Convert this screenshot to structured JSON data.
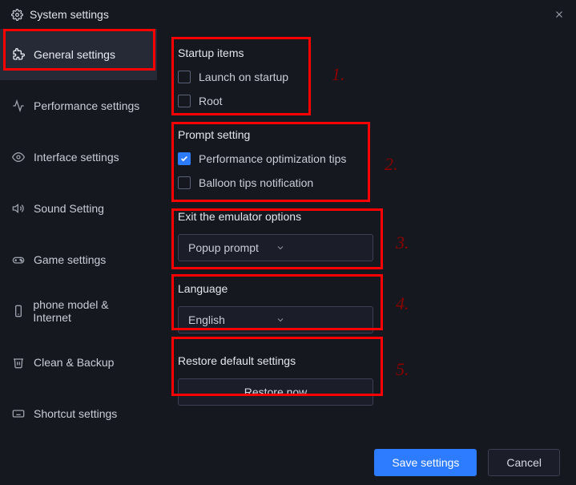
{
  "window": {
    "title": "System settings"
  },
  "sidebar": {
    "items": [
      {
        "label": "General settings"
      },
      {
        "label": "Performance settings"
      },
      {
        "label": "Interface settings"
      },
      {
        "label": "Sound Setting"
      },
      {
        "label": "Game settings"
      },
      {
        "label": "phone model & Internet"
      },
      {
        "label": "Clean & Backup"
      },
      {
        "label": "Shortcut settings"
      }
    ]
  },
  "sections": {
    "startup": {
      "title": "Startup items",
      "launch": "Launch on startup",
      "root": "Root"
    },
    "prompt": {
      "title": "Prompt setting",
      "perf_tips": "Performance optimization tips",
      "balloon": "Balloon tips notification"
    },
    "exit": {
      "title": "Exit the emulator options",
      "selected": "Popup prompt"
    },
    "language": {
      "title": "Language",
      "selected": "English"
    },
    "restore": {
      "title": "Restore default settings",
      "button": "Restore now"
    }
  },
  "footer": {
    "save": "Save settings",
    "cancel": "Cancel"
  },
  "annotations": {
    "n1": "1.",
    "n2": "2.",
    "n3": "3.",
    "n4": "4.",
    "n5": "5."
  }
}
